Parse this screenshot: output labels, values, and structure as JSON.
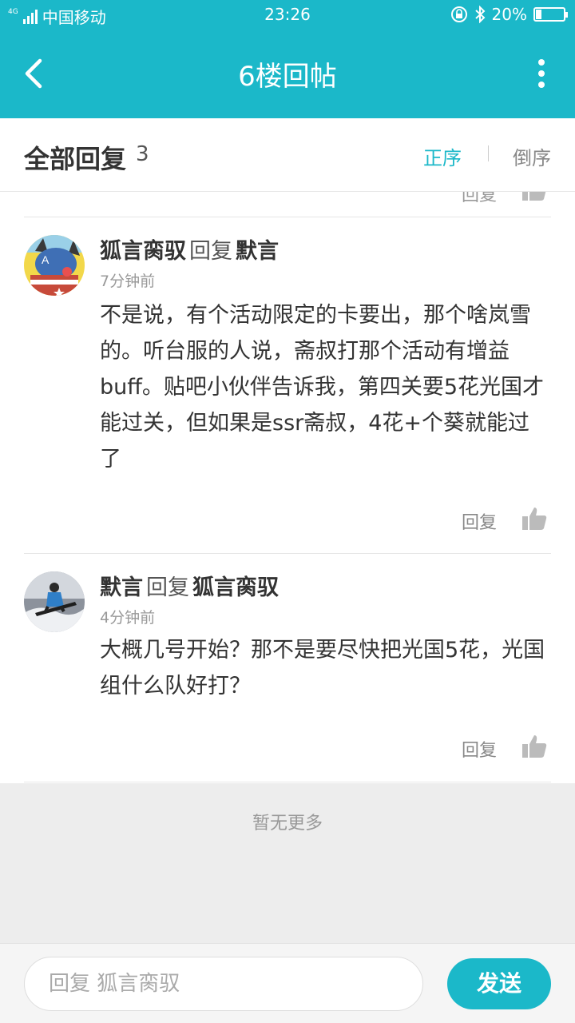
{
  "status_bar": {
    "network_type": "4G",
    "carrier": "中国移动",
    "time": "23:26",
    "battery": "20%",
    "battery_level": 0.2
  },
  "nav": {
    "title": "6楼回帖",
    "back_icon": "chevron-left-icon",
    "more_icon": "more-vertical-icon"
  },
  "header": {
    "label": "全部回复",
    "count": "3",
    "sort_asc": "正序",
    "sort_desc": "倒序"
  },
  "posts": [
    {
      "author": "狐言脔驭",
      "reply_word": "回复",
      "target": "默言",
      "time": "7分钟前",
      "text": "不是说，有个活动限定的卡要出，那个啥岚雪的。听台服的人说，斋叔打那个活动有增益buff。贴吧小伙伴告诉我，第四关要5花光国才能过关，但如果是ssr斋叔，4花+个葵就能过了",
      "reply_label": "回复"
    },
    {
      "author": "默言",
      "reply_word": "回复",
      "target": "狐言脔驭",
      "time": "4分钟前",
      "text": "大概几号开始？那不是要尽快把光国5花，光国组什么队好打？",
      "reply_label": "回复"
    }
  ],
  "partial_reply_label": "回复",
  "no_more": "暂无更多",
  "bottom": {
    "input_placeholder": "回复 狐言脔驭",
    "send": "发送"
  },
  "colors": {
    "accent": "#1bb8c9",
    "background": "#ededed"
  }
}
